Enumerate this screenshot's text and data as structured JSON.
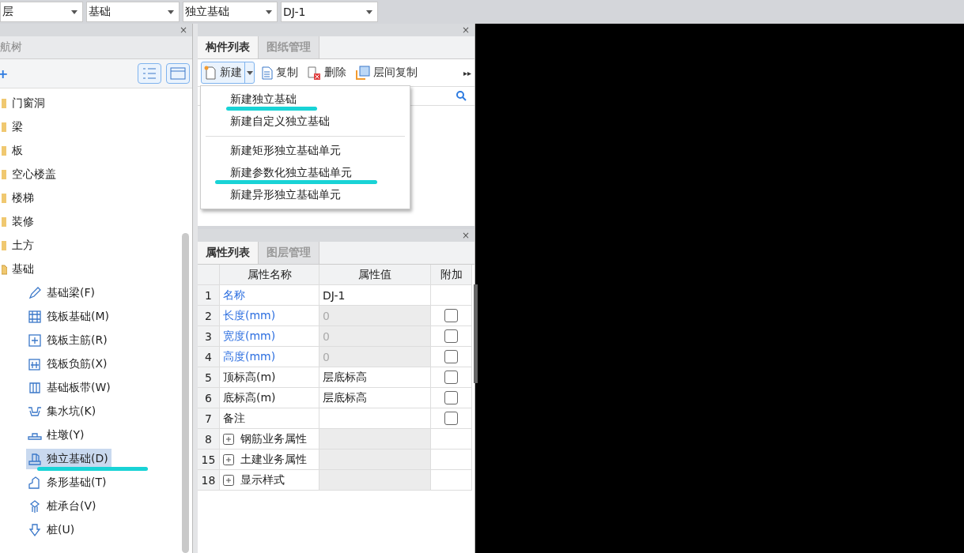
{
  "top_selectors": [
    {
      "value": "层"
    },
    {
      "value": "基础"
    },
    {
      "value": "独立基础"
    },
    {
      "value": "DJ-1"
    }
  ],
  "nav_panel": {
    "close": "×",
    "title": "航树",
    "add": "+",
    "tree": [
      {
        "label": "门窗洞",
        "expanded": false,
        "selected": false,
        "underlined": false
      },
      {
        "label": "梁",
        "expanded": false,
        "selected": false,
        "underlined": false
      },
      {
        "label": "板",
        "expanded": false,
        "selected": false,
        "underlined": false
      },
      {
        "label": "空心楼盖",
        "expanded": false,
        "selected": false,
        "underlined": false
      },
      {
        "label": "楼梯",
        "expanded": false,
        "selected": false,
        "underlined": false
      },
      {
        "label": "装修",
        "expanded": false,
        "selected": false,
        "underlined": false
      },
      {
        "label": "土方",
        "expanded": false,
        "selected": false,
        "underlined": false
      },
      {
        "label": "基础",
        "expanded": true,
        "selected": false,
        "underlined": false,
        "children": [
          {
            "label": "基础梁(F)",
            "kind": "beam",
            "selected": false,
            "underlined": false
          },
          {
            "label": "筏板基础(M)",
            "kind": "raft",
            "selected": false,
            "underlined": false
          },
          {
            "label": "筏板主筋(R)",
            "kind": "mainbar",
            "selected": false,
            "underlined": false
          },
          {
            "label": "筏板负筋(X)",
            "kind": "negbar",
            "selected": false,
            "underlined": false
          },
          {
            "label": "基础板带(W)",
            "kind": "strip",
            "selected": false,
            "underlined": false
          },
          {
            "label": "集水坑(K)",
            "kind": "pit",
            "selected": false,
            "underlined": false
          },
          {
            "label": "柱墩(Y)",
            "kind": "pier",
            "selected": false,
            "underlined": false
          },
          {
            "label": "独立基础(D)",
            "kind": "isolated",
            "selected": true,
            "underlined": true
          },
          {
            "label": "条形基础(T)",
            "kind": "stripfooting",
            "selected": false,
            "underlined": false
          },
          {
            "label": "桩承台(V)",
            "kind": "cap",
            "selected": false,
            "underlined": false
          },
          {
            "label": "桩(U)",
            "kind": "pile",
            "selected": false,
            "underlined": false
          }
        ]
      }
    ]
  },
  "component_panel": {
    "close": "×",
    "tabs": [
      {
        "label": "构件列表",
        "selected": true
      },
      {
        "label": "图纸管理",
        "selected": false
      }
    ],
    "toolbar": [
      {
        "label": "新建",
        "kind": "new"
      },
      {
        "label": "复制",
        "kind": "copy"
      },
      {
        "label": "删除",
        "kind": "delete"
      },
      {
        "label": "层间复制",
        "kind": "floorcopy"
      }
    ],
    "more": "▸▸",
    "new_menu": [
      {
        "items": [
          {
            "label": "新建独立基础",
            "underlined": true
          },
          {
            "label": "新建自定义独立基础",
            "underlined": false
          }
        ]
      },
      {
        "items": [
          {
            "label": "新建矩形独立基础单元",
            "underlined": false
          },
          {
            "label": "新建参数化独立基础单元",
            "underlined": true
          },
          {
            "label": "新建异形独立基础单元",
            "underlined": false
          }
        ]
      }
    ]
  },
  "property_panel": {
    "close": "×",
    "tabs": [
      {
        "label": "属性列表",
        "selected": true
      },
      {
        "label": "图层管理",
        "selected": false
      }
    ],
    "columns": [
      "属性名称",
      "属性值",
      "附加"
    ],
    "rows": [
      {
        "num": "1",
        "name": "名称",
        "value": "DJ-1",
        "kind": "field",
        "linked": true,
        "disabled": false,
        "checkbox": false
      },
      {
        "num": "2",
        "name": "长度(mm)",
        "value": "0",
        "kind": "field",
        "linked": true,
        "disabled": true,
        "checkbox": true,
        "checked": false
      },
      {
        "num": "3",
        "name": "宽度(mm)",
        "value": "0",
        "kind": "field",
        "linked": true,
        "disabled": true,
        "checkbox": true,
        "checked": false
      },
      {
        "num": "4",
        "name": "高度(mm)",
        "value": "0",
        "kind": "field",
        "linked": true,
        "disabled": true,
        "checkbox": true,
        "checked": false
      },
      {
        "num": "5",
        "name": "顶标高(m)",
        "value": "层底标高",
        "kind": "field",
        "linked": false,
        "disabled": false,
        "checkbox": true,
        "checked": false
      },
      {
        "num": "6",
        "name": "底标高(m)",
        "value": "层底标高",
        "kind": "field",
        "linked": false,
        "disabled": false,
        "checkbox": true,
        "checked": false
      },
      {
        "num": "7",
        "name": "备注",
        "kind": "field",
        "linked": false,
        "disabled": false,
        "checkbox": true,
        "checked": false
      },
      {
        "num": "8",
        "name": "钢筋业务属性",
        "kind": "group",
        "expanded": false
      },
      {
        "num": "15",
        "name": "土建业务属性",
        "kind": "group",
        "expanded": false
      },
      {
        "num": "18",
        "name": "显示样式",
        "kind": "group",
        "expanded": false
      }
    ]
  }
}
